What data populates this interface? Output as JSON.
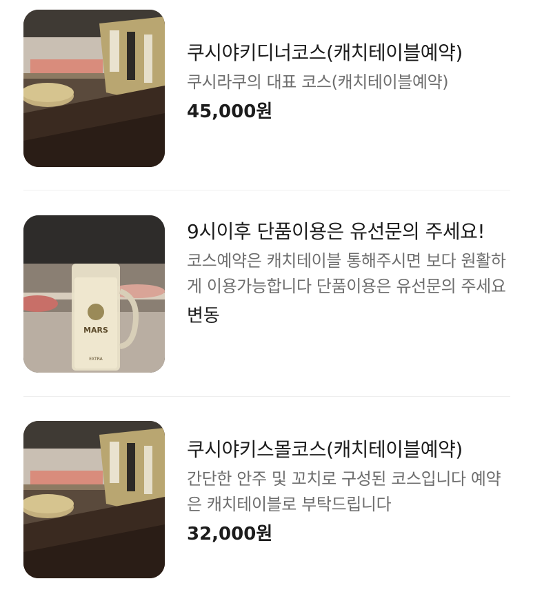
{
  "menu": {
    "items": [
      {
        "title": "쿠시야키디너코스(캐치테이블예약)",
        "description": "쿠시라쿠의 대표 코스(캐치테이블예약)",
        "price": "45,000원",
        "image_icon": "skewer-counter-photo"
      },
      {
        "title": "9시이후 단품이용은 유선문의 주세요!",
        "description": "코스예약은 캐치테이블 통해주시면 보다 원활하게 이용가능합니다 단품이용은 유선문의 주세요",
        "price": "변동",
        "image_icon": "highball-glass-photo"
      },
      {
        "title": "쿠시야키스몰코스(캐치테이블예약)",
        "description": "간단한 안주 및 꼬치로 구성된 코스입니다 예약은 캐치테이블로 부탁드립니다",
        "price": "32,000원",
        "image_icon": "skewer-counter-photo"
      }
    ]
  },
  "photo_labels": {
    "glass_brand": "MARS",
    "glass_sub": "EXTRA"
  }
}
